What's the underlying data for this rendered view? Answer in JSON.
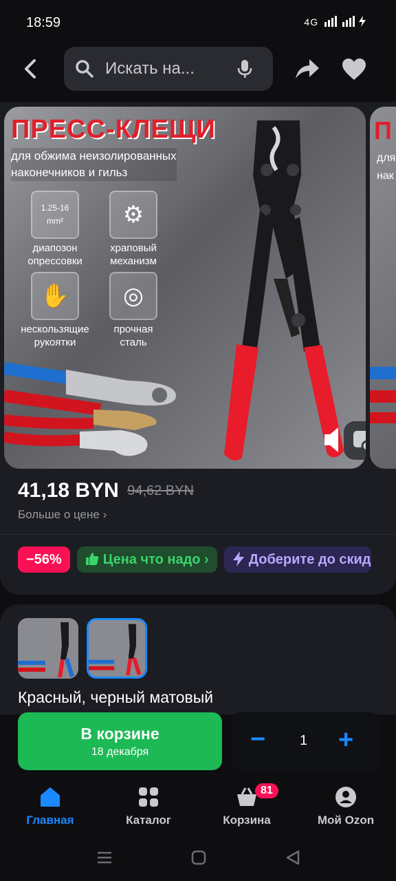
{
  "status": {
    "time": "18:59",
    "signal": "4G"
  },
  "header": {
    "back_icon": "chevron-left-icon",
    "search_placeholder": "Искать на...",
    "mic_icon": "microphone-icon",
    "share_icon": "share-icon",
    "favorite_icon": "heart-icon"
  },
  "gallery": {
    "title": "ПРЕСС-КЛЕЩИ",
    "subtitle_line1": "для обжима неизолированных",
    "subtitle_line2": "наконечников и гильз",
    "features": [
      {
        "label_line1": "диапозон",
        "label_line2": "опрессовки",
        "icon_text": "1.25-16 mm²"
      },
      {
        "label_line1": "храповый",
        "label_line2": "механизм",
        "icon_text": "⚙"
      },
      {
        "label_line1": "нескользящие",
        "label_line2": "рукоятки",
        "icon_text": "✋"
      },
      {
        "label_line1": "прочная",
        "label_line2": "сталь",
        "icon_text": "◎"
      }
    ],
    "next_title": "П",
    "next_sub1": "для",
    "next_sub2": "нак"
  },
  "price": {
    "current": "41,18 BYN",
    "old": "94,62 BYN",
    "more_link": "Больше о цене ›"
  },
  "badges": {
    "discount": "−56%",
    "deal": "Цена что надо ›",
    "promo": "Доберите до скид"
  },
  "variant": {
    "label": "Красный, черный матовый"
  },
  "cart": {
    "button_label": "В корзине",
    "delivery_date": "18 декабря",
    "quantity": "1",
    "minus": "−",
    "plus": "+"
  },
  "tabs": [
    {
      "label": "Главная",
      "icon": "home-icon"
    },
    {
      "label": "Каталог",
      "icon": "catalog-icon"
    },
    {
      "label": "Корзина",
      "icon": "basket-icon",
      "badge": "81"
    },
    {
      "label": "Мой Ozon",
      "icon": "profile-icon"
    }
  ],
  "colors": {
    "accent": "#1a88ff",
    "cart_green": "#1db954",
    "discount_pink": "#f91155"
  }
}
